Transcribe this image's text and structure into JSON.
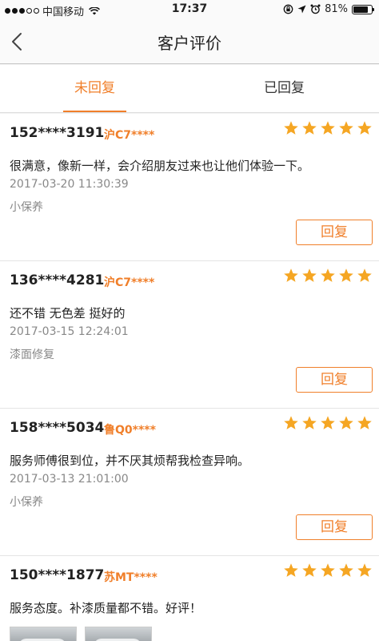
{
  "status_bar": {
    "carrier": "中国移动",
    "time": "17:37",
    "battery": "81%",
    "battery_level": 0.81
  },
  "nav": {
    "title": "客户评价"
  },
  "tabs": [
    {
      "label": "未回复"
    },
    {
      "label": "已回复"
    }
  ],
  "reviews": [
    {
      "phone": "152****3191",
      "plate": "沪C7****",
      "stars": 5,
      "content": "很满意，像新一样，会介绍朋友过来也让他们体验一下。",
      "time": "2017-03-20 11:30:39",
      "service": "小保养",
      "reply_label": "回复"
    },
    {
      "phone": "136****4281",
      "plate": "沪C7****",
      "stars": 5,
      "content": "还不错 无色差 挺好的",
      "time": "2017-03-15 12:24:01",
      "service": "漆面修复",
      "reply_label": "回复"
    },
    {
      "phone": "158****5034",
      "plate": "鲁Q0****",
      "stars": 5,
      "content": "服务师傅很到位，并不厌其烦帮我检查异响。",
      "time": "2017-03-13 21:01:00",
      "service": "小保养",
      "reply_label": "回复"
    },
    {
      "phone": "150****1877",
      "plate": "苏MT****",
      "stars": 5,
      "content": "服务态度。补漆质量都不错。好评！"
    }
  ],
  "colors": {
    "accent": "#f07f2a",
    "star": "#f5a623"
  }
}
